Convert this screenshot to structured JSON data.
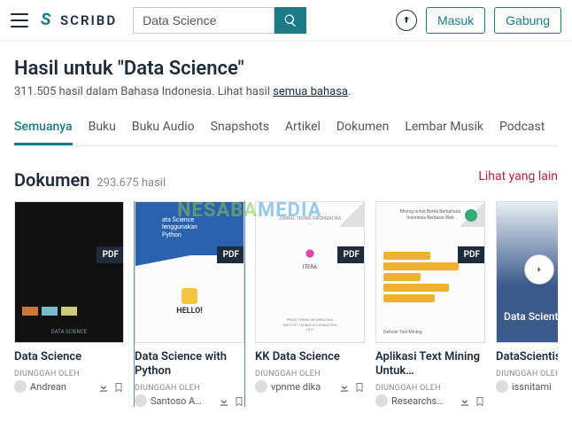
{
  "header": {
    "logo_text": "SCRIBD",
    "search_value": "Data Science",
    "login_btn": "Masuk",
    "join_btn": "Gabung"
  },
  "results": {
    "title": "Hasil untuk \"Data Science\"",
    "subtitle_count": "311.505 hasil dalam Bahasa Indonesia. Lihat hasil ",
    "subtitle_link": "semua bahasa",
    "subtitle_end": "."
  },
  "tabs": [
    "Semuanya",
    "Buku",
    "Buku Audio",
    "Snapshots",
    "Artikel",
    "Dokumen",
    "Lembar Musik",
    "Podcast"
  ],
  "section": {
    "title": "Dokumen",
    "count": "293.675 hasil",
    "see_more": "Lihat yang lain"
  },
  "watermark": {
    "a": "NESABA",
    "b": "MEDIA"
  },
  "pdf_label": "PDF",
  "uploaded_by": "DIUNGGAH OLEH",
  "cards": [
    {
      "title": "Data Science",
      "author": "Andrean"
    },
    {
      "title": "Data Science with Python",
      "author": "Santoso A…"
    },
    {
      "title": "KK Data Science",
      "author": "vpnme dika"
    },
    {
      "title": "Aplikasi Text Mining Untuk…",
      "author": "Researchs…"
    },
    {
      "title": "DataScientis",
      "author": "issnitami"
    }
  ],
  "thumb1": {
    "line1": "ata Science",
    "line2": "lenggunakan",
    "line3": "Python",
    "hello": "HELLO!"
  },
  "thumb2": {
    "brand": "ITERA"
  },
  "thumb4": {
    "text": "Data Scienti"
  }
}
